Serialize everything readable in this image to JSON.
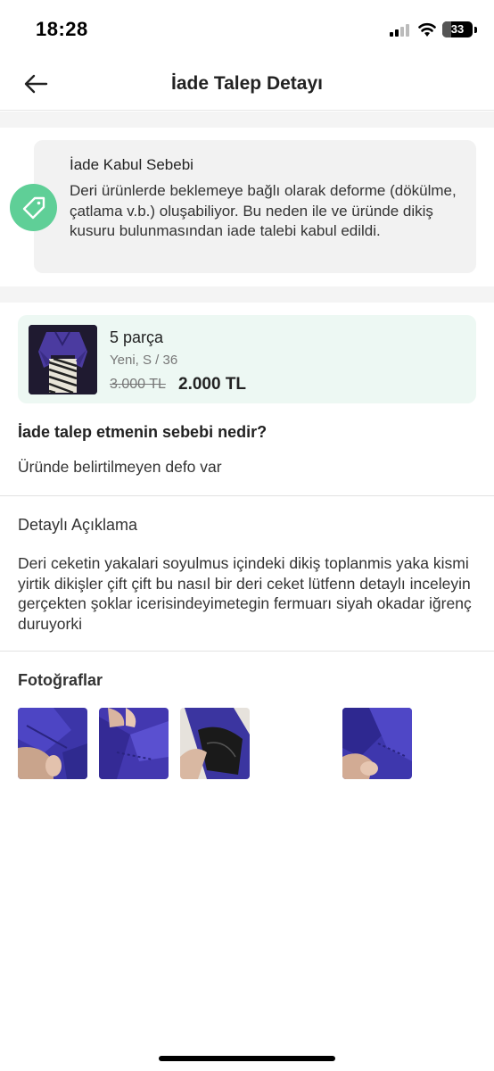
{
  "status_bar": {
    "time": "18:28",
    "battery": "33"
  },
  "header": {
    "title": "İade Talep Detayı",
    "back_icon": "arrow-left-icon"
  },
  "acceptance": {
    "title": "İade Kabul Sebebi",
    "text": "Deri ürünlerde beklemeye bağlı olarak deforme (dökülme, çatlama v.b.) oluşabiliyor. Bu neden ile ve üründe dikiş kusuru bulunmasından iade talebi kabul edildi.",
    "icon": "tag-icon",
    "icon_color": "#5fcf97"
  },
  "product": {
    "quantity": "5 parça",
    "subtitle": "Yeni, S / 36",
    "old_price": "3.000 TL",
    "new_price": "2.000 TL",
    "card_color": "#edf8f3"
  },
  "reason": {
    "question": "İade talep etmenin sebebi nedir?",
    "answer": "Üründe belirtilmeyen defo var"
  },
  "details": {
    "title": "Detaylı Açıklama",
    "text": "Deri ceketin yakalari soyulmus içindeki dikiş toplanmis yaka kismi yirtik dikişler çift çift bu nasıl bir deri ceket lütfenn detaylı inceleyin gerçekten şoklar icerisindeyimetegin fermuarı siyah okadar iğrenç duruyorki"
  },
  "photos": {
    "title": "Fotoğraflar",
    "count": 4
  }
}
